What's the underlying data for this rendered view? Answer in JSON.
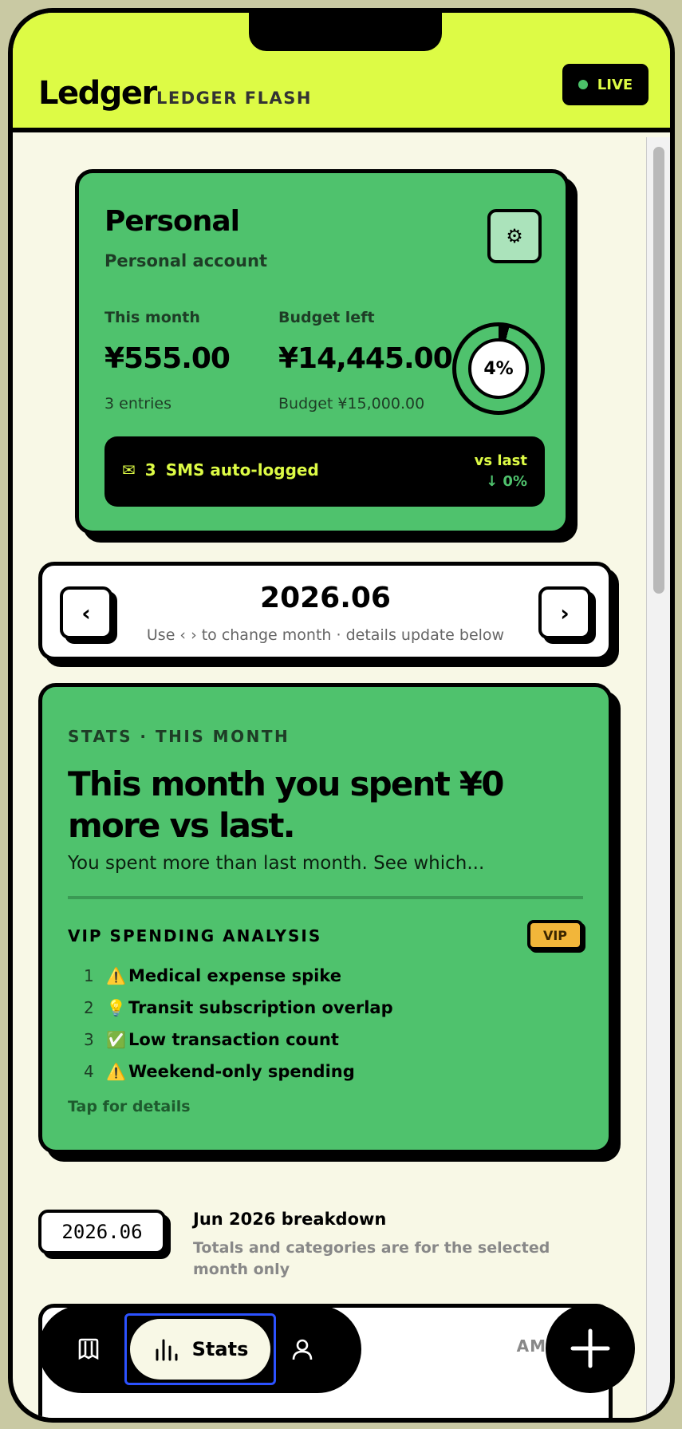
{
  "app": {
    "brand": "Ledger",
    "brand_sub": "LEDGER FLASH",
    "live_label": "LIVE"
  },
  "account": {
    "name": "Personal",
    "type": "Personal account",
    "this_month_label": "This month",
    "this_month_value": "¥555.00",
    "entries": "3 entries",
    "budget_left_label": "Budget left",
    "budget_left_value": "¥14,445.00",
    "budget_total": "Budget ¥15,000.00",
    "budget_used_percent": 4,
    "budget_used_label": "4%",
    "sms_count": "3",
    "sms_label": "SMS auto-logged",
    "vs_last_label": "vs last",
    "vs_last_value": "↓ 0%"
  },
  "month_nav": {
    "prev": "‹",
    "next": "›",
    "current": "2026.06",
    "hint": "Use ‹ › to change month · details update below"
  },
  "stats": {
    "eyebrow": "STATS · THIS MONTH",
    "headline": "This month you spent ¥0 more vs last.",
    "description": "You spent more than last month. See which...",
    "vip_title": "VIP SPENDING ANALYSIS",
    "vip_badge": "VIP",
    "insights": [
      {
        "num": "1",
        "icon": "⚠️",
        "text": "Medical expense spike"
      },
      {
        "num": "2",
        "icon": "💡",
        "text": "Transit subscription overlap"
      },
      {
        "num": "3",
        "icon": "✅",
        "text": "Low transaction count"
      },
      {
        "num": "4",
        "icon": "⚠️",
        "text": "Weekend-only spending"
      }
    ],
    "tap_details": "Tap for details"
  },
  "breakdown": {
    "date_chip": "2026.06",
    "title": "Jun 2026 breakdown",
    "subtitle": "Totals and categories are for the selected month only",
    "amount_header": "AMO"
  },
  "tabbar": {
    "active_label": "Stats"
  },
  "colors": {
    "accent": "#ddfb45",
    "card_green": "#4fc26d",
    "vip_gold": "#f2b63a",
    "background": "#f8f8e6"
  }
}
